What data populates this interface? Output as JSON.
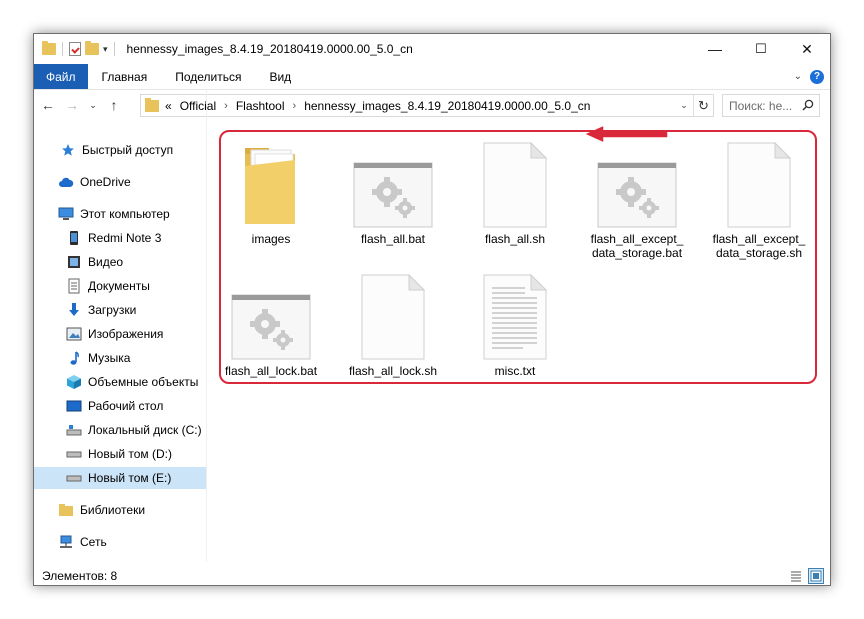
{
  "window": {
    "title": "hennessy_images_8.4.19_20180419.0000.00_5.0_cn",
    "controls": {
      "minimize": "—",
      "maximize": "☐",
      "close": "✕"
    }
  },
  "ribbon": {
    "tabs": [
      "Файл",
      "Главная",
      "Поделиться",
      "Вид"
    ]
  },
  "address": {
    "prefix": "«",
    "crumbs": [
      "Official",
      "Flashtool",
      "hennessy_images_8.4.19_20180419.0000.00_5.0_cn"
    ]
  },
  "search": {
    "placeholder": "Поиск: he..."
  },
  "sidebar": {
    "items": [
      {
        "label": "Быстрый доступ",
        "icon": "star-icon"
      },
      {
        "label": "OneDrive",
        "icon": "cloud-icon"
      },
      {
        "label": "Этот компьютер",
        "icon": "computer-icon"
      },
      {
        "label": "Redmi Note 3",
        "icon": "phone-icon"
      },
      {
        "label": "Видео",
        "icon": "video-icon"
      },
      {
        "label": "Документы",
        "icon": "documents-icon"
      },
      {
        "label": "Загрузки",
        "icon": "downloads-icon"
      },
      {
        "label": "Изображения",
        "icon": "pictures-icon"
      },
      {
        "label": "Музыка",
        "icon": "music-icon"
      },
      {
        "label": "Объемные объекты",
        "icon": "3d-objects-icon"
      },
      {
        "label": "Рабочий стол",
        "icon": "desktop-icon"
      },
      {
        "label": "Локальный диск (C:)",
        "icon": "drive-c-icon"
      },
      {
        "label": "Новый том (D:)",
        "icon": "drive-icon"
      },
      {
        "label": "Новый том (E:)",
        "icon": "drive-icon",
        "selected": true
      },
      {
        "label": "Библиотеки",
        "icon": "libraries-icon"
      },
      {
        "label": "Сеть",
        "icon": "network-icon"
      }
    ]
  },
  "files": [
    {
      "name": "images",
      "type": "folder"
    },
    {
      "name": "flash_all.bat",
      "type": "bat"
    },
    {
      "name": "flash_all.sh",
      "type": "blank"
    },
    {
      "name_line1": "flash_all_except_",
      "name_line2": "data_storage.bat",
      "type": "bat"
    },
    {
      "name_line1": "flash_all_except_",
      "name_line2": "data_storage.sh",
      "type": "blank"
    },
    {
      "name": "flash_all_lock.bat",
      "type": "bat"
    },
    {
      "name": "flash_all_lock.sh",
      "type": "blank"
    },
    {
      "name": "misc.txt",
      "type": "text"
    }
  ],
  "status": {
    "count_text": "Элементов: 8"
  },
  "colors": {
    "accent": "#1a5fb4",
    "highlight": "#d9283a",
    "selection": "#cce4f7",
    "folder": "#e8c25a"
  }
}
